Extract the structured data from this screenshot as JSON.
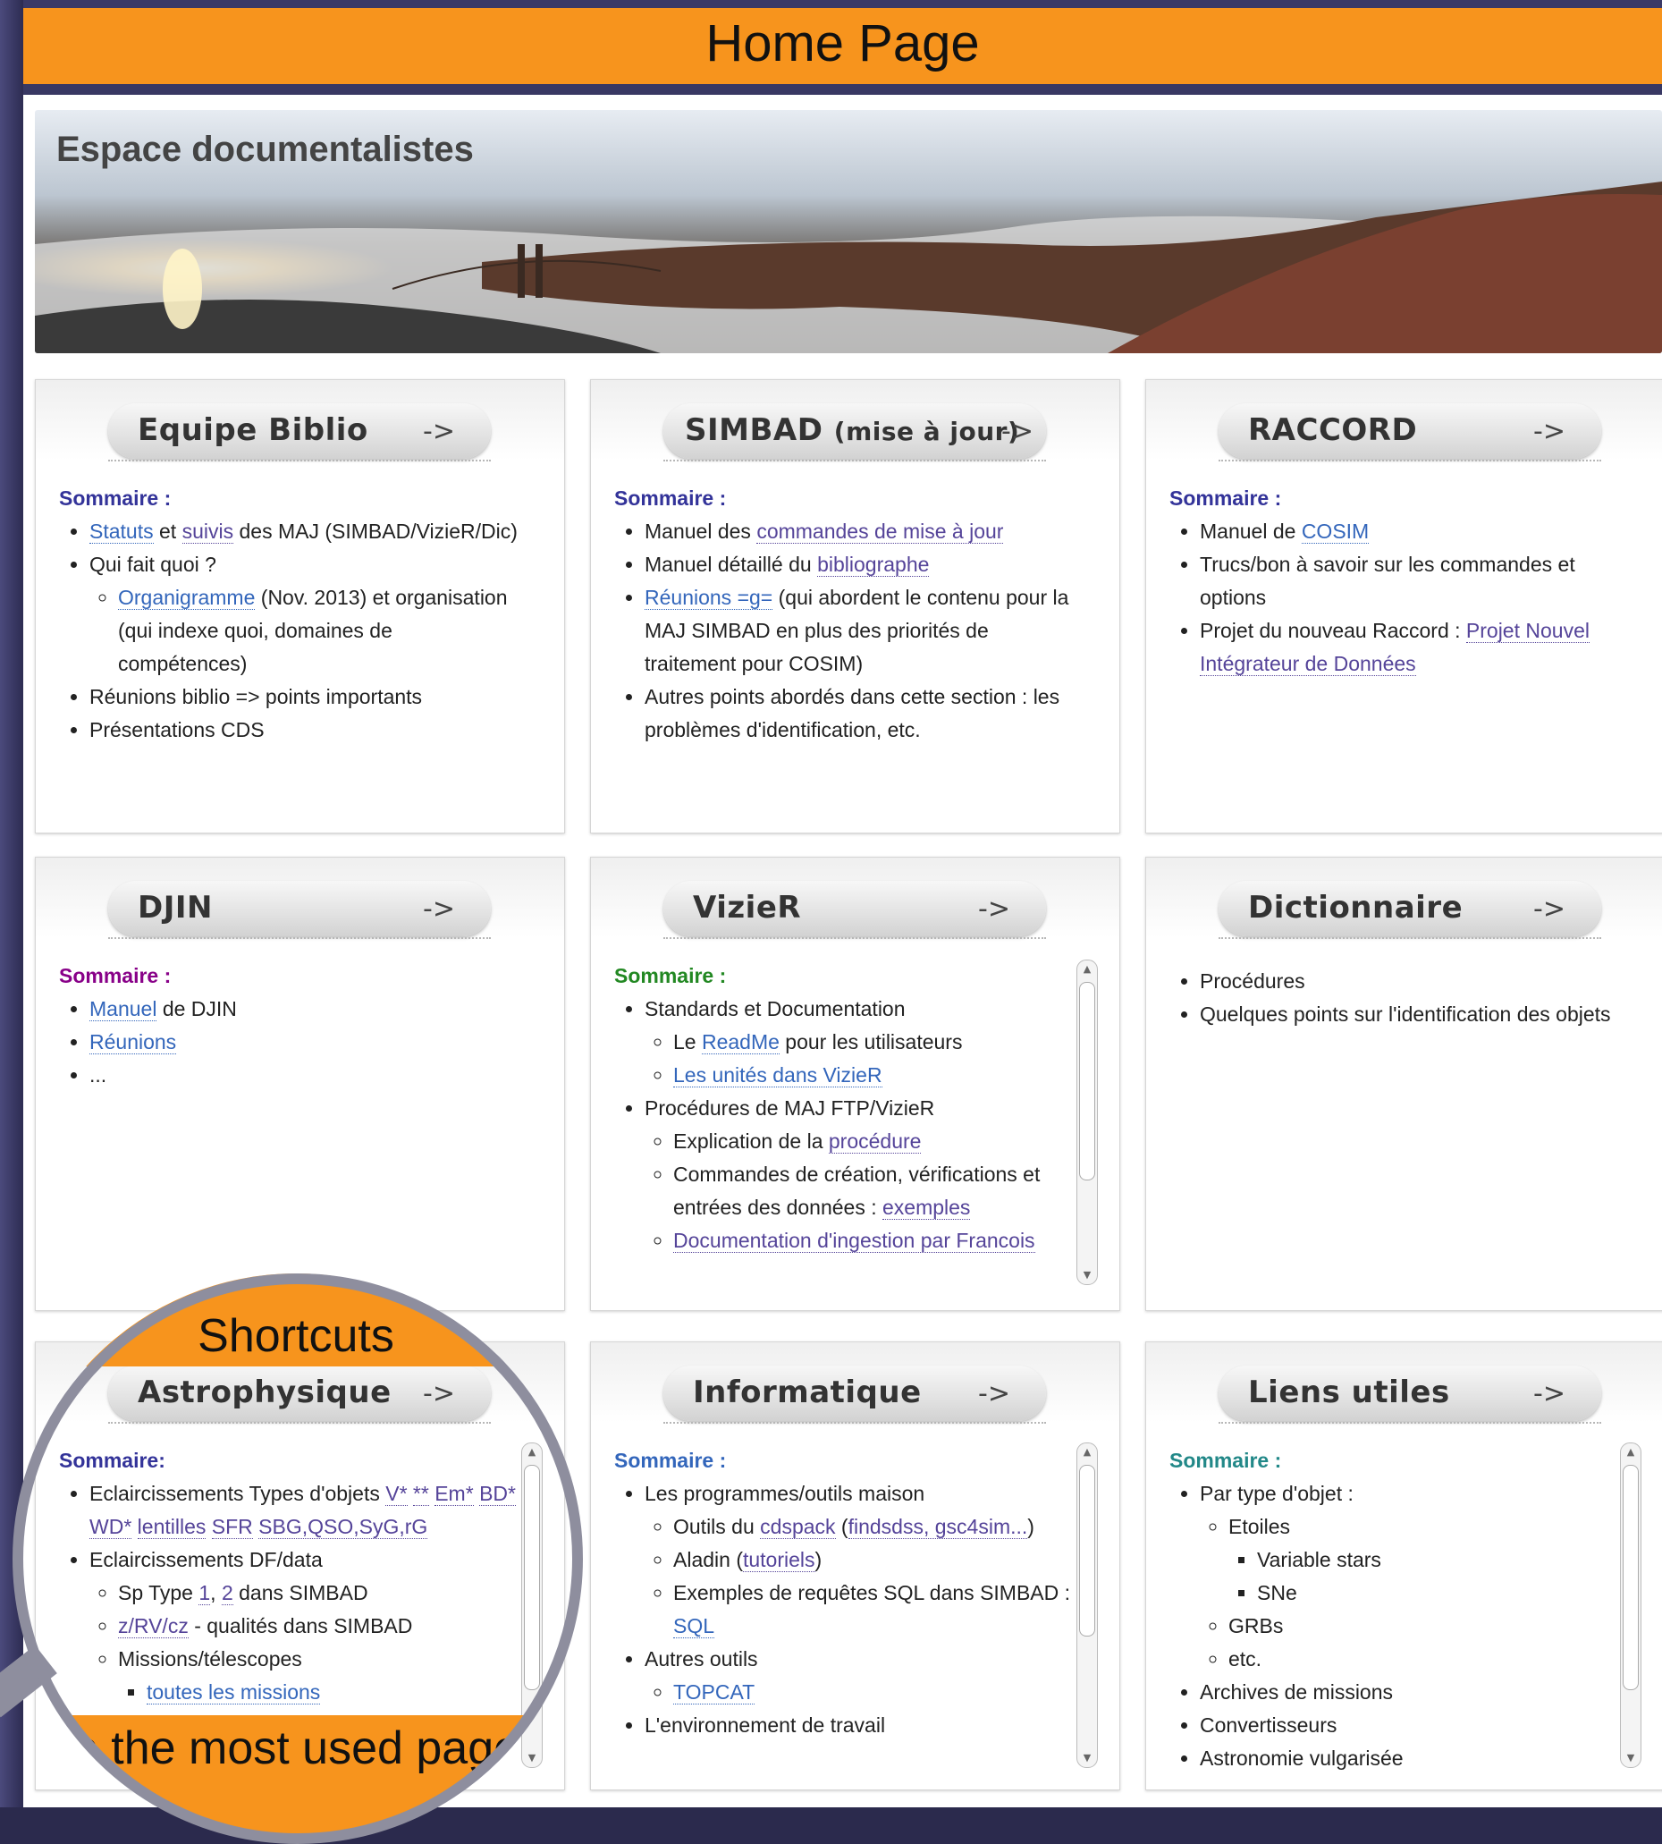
{
  "header": {
    "title": "Home Page"
  },
  "banner": {
    "title": "Espace documentalistes"
  },
  "arrow": "->",
  "cards": {
    "equipe": {
      "title": "Equipe Biblio",
      "sommaire": "Sommaire :",
      "statuts": "Statuts",
      "et": " et ",
      "suivis": "suivis",
      "des_maj": " des MAJ (SIMBAD/VizieR/Dic)",
      "qui": "Qui fait quoi ?",
      "organigramme": "Organigramme",
      "orga_rest": " (Nov. 2013) et organisation (qui indexe quoi, domaines de compétences)",
      "reunions": "Réunions biblio => points importants",
      "presentations": "Présentations CDS"
    },
    "simbad": {
      "title": "SIMBAD",
      "title_small": "(mise à jour)",
      "sommaire": "Sommaire :",
      "item1_pre": "Manuel des ",
      "item1_link": "commandes de mise à jour",
      "item2_pre": "Manuel détaillé du ",
      "item2_link": "bibliographe",
      "item3_link": "Réunions =g=",
      "item3_rest": " (qui abordent le contenu pour la MAJ SIMBAD en plus des priorités de traitement pour COSIM)",
      "item4": "Autres points abordés dans cette section : les problèmes d'identification, etc."
    },
    "raccord": {
      "title": "RACCORD",
      "sommaire": "Sommaire :",
      "item1_pre": "Manuel de ",
      "item1_link": "COSIM",
      "item2": "Trucs/bon à savoir sur les commandes et options",
      "item3_pre": "Projet du nouveau Raccord : ",
      "item3_link": "Projet Nouvel Intégrateur de Données"
    },
    "djin": {
      "title": "DJIN",
      "sommaire": "Sommaire :",
      "item1_link": "Manuel",
      "item1_rest": " de DJIN",
      "item2_link": "Réunions",
      "item3": "..."
    },
    "vizier": {
      "title": "VizieR",
      "sommaire": "Sommaire :",
      "standards": "Standards et Documentation",
      "le": "Le ",
      "readme": "ReadMe",
      "readme_rest": " pour les utilisateurs",
      "unites": "Les unités dans VizieR",
      "procedures": "Procédures de MAJ FTP/VizieR",
      "expl_pre": "Explication de la ",
      "expl_link": "procédure",
      "commandes": "Commandes de création, vérifications et entrées des données : ",
      "exemples": "exemples",
      "doc": "Documentation d'ingestion par Francois"
    },
    "dictionnaire": {
      "title": "Dictionnaire",
      "item1": "Procédures",
      "item2": "Quelques points sur l'identification des objets"
    },
    "astro": {
      "title": "Astrophysique",
      "sommaire": "Sommaire:",
      "ecl_types": "Eclaircissements Types d'objets ",
      "types_links": [
        "V*",
        "**",
        "Em*",
        "BD*",
        "WD*",
        "lentilles",
        "SFR",
        "SBG,QSO,SyG,rG"
      ],
      "ecl_df": "Eclaircissements DF/data",
      "sp_pre": "Sp Type ",
      "sp_1": "1",
      "sp_2": "2",
      "sp_rest": " dans SIMBAD",
      "zrv": "z/RV/cz",
      "zrv_rest": " - qualités dans SIMBAD",
      "missions": "Missions/télescopes",
      "toutes": "toutes les missions"
    },
    "info": {
      "title": "Informatique",
      "sommaire": "Sommaire :",
      "programmes": "Les programmes/outils maison",
      "outils_pre": "Outils du ",
      "cdspack": "cdspack",
      "findsdss": "findsdss, gsc4sim...",
      "aladin_pre": "Aladin (",
      "tutoriels": "tutoriels",
      "exemples_sql": "Exemples de requêtes SQL dans SIMBAD : ",
      "sql": "SQL",
      "autres": "Autres outils",
      "topcat": "TOPCAT",
      "env": "L'environnement de travail"
    },
    "liens": {
      "title": "Liens utiles",
      "sommaire": "Sommaire :",
      "par_type": "Par type d'objet :",
      "etoiles": "Etoiles",
      "variable": "Variable stars",
      "sne": "SNe",
      "grbs": "GRBs",
      "etc": "etc.",
      "archives": "Archives de missions",
      "convertisseurs": "Convertisseurs",
      "astronomie": "Astronomie vulgarisée"
    }
  },
  "magnifier": {
    "top_label": "Shortcuts",
    "bottom_label": "To the most used pages"
  },
  "colors": {
    "accent": "#f7941d",
    "link": "#3366bb"
  }
}
